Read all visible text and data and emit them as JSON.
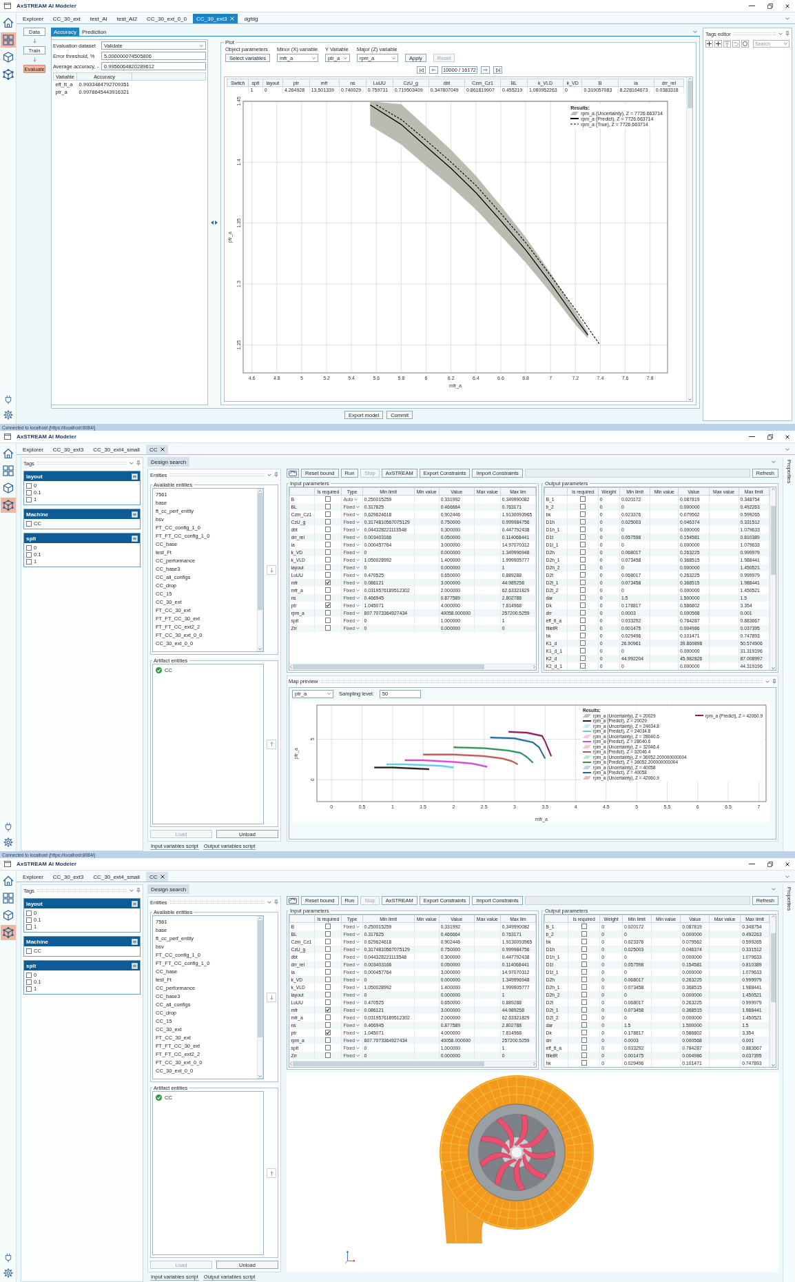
{
  "windows": [
    {
      "kind": "evaluate",
      "title": "AxSTREAM AI Modeler",
      "rail": [
        {
          "selected": false
        },
        {
          "selected": true
        },
        {
          "selected": false
        },
        {
          "selected": false
        }
      ],
      "tabs_focused": true,
      "tabs": [
        {
          "label": "Explorer",
          "selected": false
        },
        {
          "label": "CC_30_ext",
          "selected": false
        },
        {
          "label": "test_AI",
          "selected": false
        },
        {
          "label": "test_AI2",
          "selected": false
        },
        {
          "label": "CC_30_ext_0_0",
          "selected": false
        },
        {
          "label": "CC_30_ext3",
          "selected": true
        },
        {
          "label": "dgfdg",
          "selected": false
        }
      ],
      "steps": [
        {
          "label": "Data",
          "selected": false
        },
        {
          "label": "Train",
          "selected": false
        },
        {
          "label": "Evaluate",
          "selected": true
        }
      ],
      "panel_tabs": [
        {
          "label": "Accuracy",
          "selected": true
        },
        {
          "label": "Prediction",
          "selected": false
        }
      ],
      "fields": [
        {
          "kind": "dropdown",
          "label": "Evaluation dataset",
          "value": "Validate"
        },
        {
          "kind": "text",
          "label": "Error threshold, %",
          "value": "5.000000074505806"
        },
        {
          "kind": "text",
          "label": "Average accuracy, -",
          "value": "0.9956064820289612"
        }
      ],
      "accuracy_table": {
        "columns": [
          "Variable",
          "Accuracy"
        ],
        "rows": [
          [
            "eff_tt_a",
            "0.9933484792709351"
          ],
          [
            "ptr_a",
            "0.9978645443916321"
          ]
        ]
      },
      "plot": {
        "title": "Plot",
        "controls": [
          {
            "kind": "button",
            "label": "Object parameters",
            "value": "Select variables"
          },
          {
            "kind": "dropdown",
            "label": "Minor (X) variable",
            "value": "mfr_a"
          },
          {
            "kind": "dropdown",
            "label": "Y Variable",
            "value": "ptr_a"
          },
          {
            "kind": "dropdown",
            "label": "Major (Z) variable",
            "value": "rpm_a"
          }
        ],
        "actions": [
          {
            "label": "Apply",
            "disabled": false
          },
          {
            "label": "Reset",
            "disabled": true
          }
        ],
        "pager": "10000 / 16172",
        "table": {
          "columns": [
            "Switch",
            "splt",
            "layout",
            "ptr",
            "mfr",
            "ns",
            "LuUU",
            "CzU_g",
            "dbt",
            "Czm_Cz1",
            "BL",
            "k_VLD",
            "k_VD",
            "B",
            "ia",
            "drr_rel"
          ],
          "rows": [
            [
              null,
              "1",
              "0",
              "4.264928",
              "13.501339",
              "0.740029",
              "0.759731",
              "0.719503409",
              "0.347807049",
              "0.861819907",
              "0.455219",
              "1.080952263",
              "0",
              "0.319057083",
              "8.228164673",
              "0.0383318"
            ]
          ]
        },
        "uncertainty": [
          {
            "label": "rpm_a (Uncertainty), Z = 7726.663714",
            "color": "#b9bdb1"
          }
        ],
        "chart_data": {
          "type": "line",
          "xlabel": "mfr_a",
          "ylabel": "ptr_a",
          "grid": true,
          "legend": "upper right",
          "legend_title": "Results:",
          "xlim": [
            4.53,
            7.94
          ],
          "ylim": [
            1.227,
            1.45
          ],
          "xticks": [
            4.6,
            4.8,
            5,
            5.2,
            5.4,
            5.6,
            5.8,
            6,
            6.2,
            6.4,
            6.6,
            6.8,
            7,
            7.2,
            7.4,
            7.6,
            7.8
          ],
          "yticks": [
            1.25,
            1.3,
            1.35,
            1.4,
            1.45
          ],
          "series": [
            {
              "name": "rpm_a (Predict), Z = 7726.663714",
              "color": "#000000",
              "x": [
                5.55,
                5.8,
                6.0,
                6.2,
                6.4,
                6.6,
                6.8,
                7.0,
                7.2,
                7.3
              ],
              "values": [
                1.447,
                1.431,
                1.413,
                1.395,
                1.375,
                1.352,
                1.328,
                1.301,
                1.272,
                1.258
              ]
            },
            {
              "name": "rpm_a (True), Z = 7726.663714",
              "color": "#000000",
              "line_style": "dashed",
              "x": [
                5.6,
                5.8,
                6.0,
                6.2,
                6.4,
                6.6,
                6.8,
                7.0,
                7.2,
                7.39
              ],
              "values": [
                1.447,
                1.435,
                1.418,
                1.4,
                1.381,
                1.358,
                1.334,
                1.307,
                1.279,
                1.251
              ]
            }
          ]
        }
      },
      "footer_buttons": [
        "Export model",
        "Commit"
      ],
      "tags_editor": {
        "title": "Tags editor",
        "search_placeholder": "Search"
      },
      "status": "Connected to localhost (https://localhost:8084/)"
    },
    {
      "kind": "design_search",
      "title": "AxSTREAM AI Modeler",
      "rail": [
        {
          "selected": false
        },
        {
          "selected": false
        },
        {
          "selected": false
        },
        {
          "selected": true
        }
      ],
      "tabs_focused": false,
      "tabs": [
        {
          "label": "Explorer",
          "selected": false
        },
        {
          "label": "CC_30_ext3",
          "selected": false
        },
        {
          "label": "CC_30_ext4_small",
          "selected": false
        },
        {
          "label": "CC",
          "selected": true
        }
      ],
      "tags": {
        "title": "Tags",
        "groups": [
          {
            "name": "layout",
            "options": [
              {
                "label": "0",
                "checked": false
              },
              {
                "label": "0.1",
                "checked": false
              },
              {
                "label": "1",
                "checked": false
              }
            ]
          },
          {
            "name": "Machine",
            "options": [
              {
                "label": "CC",
                "checked": false
              }
            ]
          },
          {
            "name": "splt",
            "options": [
              {
                "label": "0",
                "checked": false
              },
              {
                "label": "0.1",
                "checked": false
              },
              {
                "label": "1",
                "checked": false
              }
            ]
          }
        ]
      },
      "page_tabs": [
        {
          "label": "Design search",
          "selected": true
        }
      ],
      "entities": {
        "title": "Entities",
        "available_title": "Available entities",
        "available": [
          "7561",
          "base",
          "ft_cc_perf_entity",
          "bsv",
          "FT_CC_config_1_0",
          "FT_FT_CC_config_1_0",
          "CC_base",
          "test_Ft",
          "CC_performance",
          "CC_base3",
          "CC_all_configs",
          "CC_drop",
          "CC_15",
          "CC_30_ext",
          "FT_CC_30_ext",
          "FT_FT_CC_30_ext",
          "FT_FT_CC_ext2_2",
          "FT_CC_30_ext_0_0",
          "CC_30_ext_0_0"
        ],
        "artifact_title": "Artifact entities",
        "artifacts": [
          "CC"
        ],
        "buttons": [
          {
            "label": "Load",
            "disabled": true
          },
          {
            "label": "Unload",
            "disabled": false
          }
        ]
      },
      "toolbar": [
        {
          "label": "Reset bound",
          "disabled": false
        },
        {
          "label": "Run",
          "disabled": false
        },
        {
          "label": "Stop",
          "disabled": true
        },
        {
          "label": "AxSTREAM",
          "disabled": false
        },
        {
          "label": "Export Constraints",
          "disabled": false
        },
        {
          "label": "Import Constraints",
          "disabled": false
        }
      ],
      "refresh": "Refresh",
      "inputs": {
        "kind": "input",
        "title": "Input parameters",
        "columns": [
          "Is required",
          "Type",
          "Min limit",
          "Min value",
          "Value",
          "Max value",
          "Max lim"
        ],
        "rows": [
          {
            "name": "B",
            "required": false,
            "type": "Auto",
            "min_limit": "0.250015259",
            "value": "0.331992",
            "max_limit": "0.349990082"
          },
          {
            "name": "BL",
            "required": false,
            "type": "Fixed",
            "min_limit": "0.317625",
            "value": "0.466664",
            "max_limit": "0.763171"
          },
          {
            "name": "Czm_Cz1",
            "required": false,
            "type": "Fixed",
            "min_limit": "0.629624618",
            "value": "0.902446",
            "max_limit": "1.9130093965"
          },
          {
            "name": "CzU_g",
            "required": false,
            "type": "Fixed",
            "min_limit": "0.3174810567075129",
            "value": "0.750000",
            "max_limit": "0.999984756"
          },
          {
            "name": "dbt",
            "required": false,
            "type": "Fixed",
            "min_limit": "0.044328221113548",
            "value": "0.300000",
            "max_limit": "0.447792438"
          },
          {
            "name": "drr_rel",
            "required": false,
            "type": "Fixed",
            "min_limit": "0.003403166",
            "value": "0.050000",
            "max_limit": "0.114068441"
          },
          {
            "name": "ia",
            "required": false,
            "type": "Fixed",
            "min_limit": "0.000457764",
            "value": "3.000000",
            "max_limit": "14.97070312"
          },
          {
            "name": "k_VD",
            "required": false,
            "type": "Fixed",
            "min_limit": "0",
            "value": "0.000000",
            "max_limit": "1.349996948"
          },
          {
            "name": "k_VLD",
            "required": false,
            "type": "Fixed",
            "min_limit": "1.050028992",
            "value": "1.400000",
            "max_limit": "1.999905777"
          },
          {
            "name": "layout",
            "required": false,
            "type": "Fixed",
            "min_limit": "0",
            "value": "0.000000",
            "max_limit": "1"
          },
          {
            "name": "LuUU",
            "required": false,
            "type": "Fixed",
            "min_limit": "0.470525",
            "value": "0.650000",
            "max_limit": "0.889288"
          },
          {
            "name": "mfr",
            "required": true,
            "type": "Fixed",
            "min_limit": "0.086121",
            "value": "3.000000",
            "max_limit": "44.989258"
          },
          {
            "name": "mfr_a",
            "required": false,
            "type": "Fixed",
            "min_limit": "0.0319576189512302",
            "value": "2.000000",
            "max_limit": "62.63321829"
          },
          {
            "name": "ns",
            "required": false,
            "type": "Fixed",
            "min_limit": "0.466945",
            "value": "0.877589",
            "max_limit": "2.802788"
          },
          {
            "name": "ptr",
            "required": true,
            "type": "Fixed",
            "min_limit": "1.045071",
            "value": "4.000000",
            "max_limit": "7.814968"
          },
          {
            "name": "rpm_a",
            "required": false,
            "type": "Fixed",
            "min_limit": "807.7073364927434",
            "value": "40058.000000",
            "max_limit": "257200.5259"
          },
          {
            "name": "splt",
            "required": false,
            "type": "Fixed",
            "min_limit": "0",
            "value": "1.000000",
            "max_limit": "1"
          },
          {
            "name": "Zrr",
            "required": false,
            "type": "Fixed",
            "min_limit": "0",
            "value": "0.000000",
            "max_limit": "0"
          }
        ]
      },
      "outputs": {
        "kind": "output",
        "title": "Output parameters",
        "columns": [
          "Is required",
          "Weight",
          "Min limit",
          "Min value",
          "Value",
          "Max value",
          "Max limit"
        ],
        "rows": [
          {
            "name": "B_1",
            "required": false,
            "weight": "0",
            "min_limit": "0.020172",
            "value": "0.087819",
            "max_limit": "0.348754"
          },
          {
            "name": "b_2",
            "required": false,
            "weight": "0",
            "min_limit": "0",
            "value": "0.000000",
            "max_limit": "0.492263"
          },
          {
            "name": "bk",
            "required": false,
            "weight": "0",
            "min_limit": "0.023376",
            "value": "0.079562",
            "max_limit": "0.599265"
          },
          {
            "name": "D1h",
            "required": false,
            "weight": "0",
            "min_limit": "0.025003",
            "value": "0.046374",
            "max_limit": "0.331512"
          },
          {
            "name": "D1h_1",
            "required": false,
            "weight": "0",
            "min_limit": "0",
            "value": "0.000000",
            "max_limit": "1.079633"
          },
          {
            "name": "D1t",
            "required": false,
            "weight": "0",
            "min_limit": "0.057598",
            "value": "0.154581",
            "max_limit": "0.810389"
          },
          {
            "name": "D1t_1",
            "required": false,
            "weight": "0",
            "min_limit": "0",
            "value": "0.000000",
            "max_limit": "1.079633"
          },
          {
            "name": "D2h",
            "required": false,
            "weight": "0",
            "min_limit": "0.068017",
            "value": "0.263225",
            "max_limit": "0.999979"
          },
          {
            "name": "D2h_1",
            "required": false,
            "weight": "0",
            "min_limit": "0.073458",
            "value": "0.368515",
            "max_limit": "1.988441"
          },
          {
            "name": "D2h_2",
            "required": false,
            "weight": "0",
            "min_limit": "0",
            "value": "0.000000",
            "max_limit": "1.450521"
          },
          {
            "name": "D2t",
            "required": false,
            "weight": "0",
            "min_limit": "0.068017",
            "value": "0.263225",
            "max_limit": "0.999979"
          },
          {
            "name": "D2t_1",
            "required": false,
            "weight": "0",
            "min_limit": "0.073458",
            "value": "0.368515",
            "max_limit": "1.988441"
          },
          {
            "name": "D2t_2",
            "required": false,
            "weight": "0",
            "min_limit": "0",
            "value": "0.000000",
            "max_limit": "1.450521"
          },
          {
            "name": "dar",
            "required": false,
            "weight": "0",
            "min_limit": "1.5",
            "value": "1.500000",
            "max_limit": "1.5"
          },
          {
            "name": "Dk",
            "required": false,
            "weight": "0",
            "min_limit": "0.178817",
            "value": "0.586802",
            "max_limit": "3.354"
          },
          {
            "name": "drr",
            "required": false,
            "weight": "0",
            "min_limit": "0.0003",
            "value": "0.000568",
            "max_limit": "0.001"
          },
          {
            "name": "eff_tt_a",
            "required": false,
            "weight": "0",
            "min_limit": "0.033292",
            "value": "0.784287",
            "max_limit": "0.883667"
          },
          {
            "name": "filletR",
            "required": false,
            "weight": "0",
            "min_limit": "0.001475",
            "value": "0.004986",
            "max_limit": "0.037395"
          },
          {
            "name": "hk",
            "required": false,
            "weight": "0",
            "min_limit": "0.029496",
            "value": "0.101471",
            "max_limit": "0.747893"
          },
          {
            "name": "K1_d",
            "required": false,
            "weight": "0",
            "min_limit": "26.90961",
            "value": "39.869898",
            "max_limit": "50.574906"
          },
          {
            "name": "K1_d_1",
            "required": false,
            "weight": "0",
            "min_limit": "0",
            "value": "0.000000",
            "max_limit": "31.319196"
          },
          {
            "name": "K2_d",
            "required": false,
            "weight": "0",
            "min_limit": "44.992204",
            "value": "45.982826",
            "max_limit": "87.008997"
          },
          {
            "name": "K2_d_1",
            "required": false,
            "weight": "0",
            "min_limit": "0",
            "value": "0.000000",
            "max_limit": "44.319196"
          }
        ]
      },
      "view": {
        "kind": "map",
        "title": "Map preview",
        "variable": "ptr_a",
        "sampling_label": "Sampling level:",
        "sampling_value": "50",
        "uncertainty": [
          {
            "label": "rpm_a (Uncertainty), Z = 20029",
            "color": "#bcc0b4"
          },
          {
            "label": "rpm_a (Uncertainty), Z = 24034.8",
            "color": "#c6ecf4"
          },
          {
            "label": "rpm_a (Uncertainty), Z = 28040.6",
            "color": "#f2c4ec"
          },
          {
            "label": "rpm_a (Uncertainty), Z = 32046.4",
            "color": "#f0c6c2"
          },
          {
            "label": "rpm_a (Uncertainty), Z = 36052.200000000004",
            "color": "#c4e4d0"
          },
          {
            "label": "rpm_a (Uncertainty), Z = 40058",
            "color": "#b4d8ea"
          },
          {
            "label": "rpm_a (Uncertainty), Z = 42060.9",
            "color": "#e8b8cc"
          }
        ],
        "chart_data": {
          "type": "line",
          "xlabel": "mfr_a",
          "ylabel": "ptr_a",
          "grid": true,
          "legend": "upper right",
          "legend_title": "Results:",
          "xlim": [
            -0.24,
            7.12
          ],
          "ylim": [
            -2.7,
            9.2
          ],
          "xticks": [
            {
              "value": 0,
              "label": "0"
            },
            0.5,
            {
              "value": 1,
              "label": "1"
            },
            {
              "value": 1.5,
              "label": "1.5"
            },
            2,
            2.5,
            3,
            3.5,
            4,
            4.5,
            5,
            5.5,
            6,
            6.5,
            7
          ],
          "yticks": [
            {
              "value": 0,
              "label": "0"
            },
            5
          ],
          "series": [
            {
              "name": "rpm_a (Predict), Z = 20029",
              "color": "#1e1e1e",
              "x": [
                0.7,
                1.0,
                1.3,
                1.6
              ],
              "values": [
                1.5,
                1.5,
                1.4,
                1.3
              ]
            },
            {
              "name": "rpm_a (Predict), Z = 24034.8",
              "color": "#5ccfe0",
              "x": [
                0.9,
                1.2,
                1.5,
                1.8,
                2.0
              ],
              "values": [
                1.9,
                1.9,
                1.8,
                1.7,
                1.5
              ]
            },
            {
              "name": "rpm_a (Predict), Z = 28040.6",
              "color": "#c84fd0",
              "x": [
                1.2,
                1.5,
                2.0,
                2.3,
                2.55
              ],
              "values": [
                2.4,
                2.4,
                2.2,
                2.0,
                1.6
              ]
            },
            {
              "name": "rpm_a (Predict), Z = 32046.4",
              "color": "#b85a5a",
              "x": [
                1.5,
                2.0,
                2.5,
                2.8,
                2.95,
                3.05
              ],
              "values": [
                3.1,
                3.1,
                2.9,
                2.6,
                2.3,
                1.9
              ]
            },
            {
              "name": "rpm_a (Predict), Z = 36052.200000000004",
              "color": "#2e8f5a",
              "x": [
                2.0,
                2.5,
                2.9,
                3.1,
                3.2,
                3.3
              ],
              "values": [
                4.0,
                3.9,
                3.6,
                3.3,
                2.8,
                2.1
              ]
            },
            {
              "name": "rpm_a (Predict), Z = 40058",
              "color": "#1f6b94",
              "x": [
                2.6,
                3.0,
                3.3,
                3.4,
                3.45,
                3.5
              ],
              "values": [
                5.2,
                5.1,
                4.6,
                4.0,
                3.3,
                2.6
              ]
            },
            {
              "name": "rpm_a (Predict), Z = 42060.9",
              "color": "#8c1c5a",
              "x": [
                2.9,
                3.2,
                3.45,
                3.5,
                3.55,
                3.6
              ],
              "values": [
                5.9,
                5.8,
                5.4,
                4.7,
                3.8,
                2.9
              ]
            }
          ]
        }
      },
      "bottom_tabs": [
        "Input variables script",
        "Output variables script"
      ],
      "side_tab": "Properties",
      "status": "Connected to localhost (https://localhost:8084/)"
    },
    {
      "kind": "design_search",
      "title": "AxSTREAM AI Modeler",
      "rail": [
        {
          "selected": false
        },
        {
          "selected": false
        },
        {
          "selected": false
        },
        {
          "selected": true
        }
      ],
      "tabs_focused": false,
      "tabs": [
        {
          "label": "Explorer",
          "selected": false
        },
        {
          "label": "CC_30_ext3",
          "selected": false
        },
        {
          "label": "CC_30_ext4_small",
          "selected": false
        },
        {
          "label": "CC",
          "selected": true
        }
      ],
      "tags": {
        "title": "Tags",
        "groups": [
          {
            "name": "layout",
            "options": [
              {
                "label": "0",
                "checked": false
              },
              {
                "label": "0.1",
                "checked": false
              },
              {
                "label": "1",
                "checked": false
              }
            ]
          },
          {
            "name": "Machine",
            "options": [
              {
                "label": "CC",
                "checked": false
              }
            ]
          },
          {
            "name": "splt",
            "options": [
              {
                "label": "0",
                "checked": false
              },
              {
                "label": "0.1",
                "checked": false
              },
              {
                "label": "1",
                "checked": false
              }
            ]
          }
        ]
      },
      "page_tabs": [
        {
          "label": "Design search",
          "selected": true
        }
      ],
      "entities": {
        "title": "Entities",
        "available_title": "Available entities",
        "available": [
          "7561",
          "base",
          "ft_cc_perf_entity",
          "bsv",
          "FT_CC_config_1_0",
          "FT_FT_CC_config_1_0",
          "CC_base",
          "test_Ft",
          "CC_performance",
          "CC_base3",
          "CC_all_configs",
          "CC_drop",
          "CC_15",
          "CC_30_ext",
          "FT_CC_30_ext",
          "FT_FT_CC_30_ext",
          "FT_FT_CC_ext2_2",
          "FT_CC_30_ext_0_0",
          "CC_30_ext_0_0"
        ],
        "artifact_title": "Artifact entities",
        "artifacts": [
          "CC"
        ],
        "buttons": [
          {
            "label": "Load",
            "disabled": true
          },
          {
            "label": "Unload",
            "disabled": false
          }
        ]
      },
      "toolbar": [
        {
          "label": "Reset bound",
          "disabled": false
        },
        {
          "label": "Run",
          "disabled": false
        },
        {
          "label": "Stop",
          "disabled": true
        },
        {
          "label": "AxSTREAM",
          "disabled": false
        },
        {
          "label": "Export Constraints",
          "disabled": false
        },
        {
          "label": "Import Constraints",
          "disabled": false
        }
      ],
      "refresh": "Refresh",
      "inputs": {
        "kind": "input",
        "title": "Input parameters",
        "columns": [
          "Is required",
          "Type",
          "Min limit",
          "Min value",
          "Value",
          "Max value",
          "Max lim"
        ],
        "rows": [
          {
            "name": "B",
            "required": false,
            "type": "Fixed",
            "min_limit": "0.250015259",
            "value": "0.331992",
            "max_limit": "0.349990082"
          },
          {
            "name": "BL",
            "required": false,
            "type": "Fixed",
            "min_limit": "0.317625",
            "value": "0.466664",
            "max_limit": "0.763171"
          },
          {
            "name": "Czm_Cz1",
            "required": false,
            "type": "Fixed",
            "min_limit": "0.629624618",
            "value": "0.902446",
            "max_limit": "1.9130093965"
          },
          {
            "name": "CzU_g",
            "required": false,
            "type": "Fixed",
            "min_limit": "0.3174810567075129",
            "value": "0.750000",
            "max_limit": "0.999984756"
          },
          {
            "name": "dbt",
            "required": false,
            "type": "Fixed",
            "min_limit": "0.044328221113548",
            "value": "0.300000",
            "max_limit": "0.447792438"
          },
          {
            "name": "drr_rel",
            "required": false,
            "type": "Fixed",
            "min_limit": "0.003403166",
            "value": "0.050000",
            "max_limit": "0.114068441"
          },
          {
            "name": "ia",
            "required": false,
            "type": "Fixed",
            "min_limit": "0.000457764",
            "value": "3.000000",
            "max_limit": "14.97070312"
          },
          {
            "name": "k_VD",
            "required": false,
            "type": "Fixed",
            "min_limit": "0",
            "value": "0.000000",
            "max_limit": "1.349996948"
          },
          {
            "name": "k_VLD",
            "required": false,
            "type": "Fixed",
            "min_limit": "1.050028992",
            "value": "1.400000",
            "max_limit": "1.999905777"
          },
          {
            "name": "layout",
            "required": false,
            "type": "Fixed",
            "min_limit": "0",
            "value": "0.000000",
            "max_limit": "1"
          },
          {
            "name": "LuUU",
            "required": false,
            "type": "Fixed",
            "min_limit": "0.470525",
            "value": "0.650000",
            "max_limit": "0.889288"
          },
          {
            "name": "mfr",
            "required": true,
            "type": "Fixed",
            "min_limit": "0.086121",
            "value": "3.000000",
            "max_limit": "44.989258"
          },
          {
            "name": "mfr_a",
            "required": false,
            "type": "Fixed",
            "min_limit": "0.0319576189512302",
            "value": "2.000000",
            "max_limit": "62.63321829"
          },
          {
            "name": "ns",
            "required": false,
            "type": "Fixed",
            "min_limit": "0.466945",
            "value": "0.877589",
            "max_limit": "2.802788"
          },
          {
            "name": "ptr",
            "required": true,
            "type": "Fixed",
            "min_limit": "1.045071",
            "value": "4.000000",
            "max_limit": "7.814968"
          },
          {
            "name": "rpm_a",
            "required": false,
            "type": "Fixed",
            "min_limit": "807.7073364927434",
            "value": "40058.000000",
            "max_limit": "257200.5259"
          },
          {
            "name": "splt",
            "required": false,
            "type": "Fixed",
            "min_limit": "0",
            "value": "1.000000",
            "max_limit": "1"
          },
          {
            "name": "Zrr",
            "required": false,
            "type": "Fixed",
            "min_limit": "0",
            "value": "0.000000",
            "max_limit": "0"
          }
        ]
      },
      "outputs": {
        "kind": "output",
        "title": "Output parameters",
        "columns": [
          "Is required",
          "Weight",
          "Min limit",
          "Min value",
          "Value",
          "Max value",
          "Max limit"
        ],
        "rows": [
          {
            "name": "B_1",
            "required": false,
            "weight": "0",
            "min_limit": "0.020172",
            "value": "0.087819",
            "max_limit": "0.348754"
          },
          {
            "name": "b_2",
            "required": false,
            "weight": "0",
            "min_limit": "0",
            "value": "0.000000",
            "max_limit": "0.492263"
          },
          {
            "name": "bk",
            "required": false,
            "weight": "0",
            "min_limit": "0.023376",
            "value": "0.079562",
            "max_limit": "0.599265"
          },
          {
            "name": "D1h",
            "required": false,
            "weight": "0",
            "min_limit": "0.025003",
            "value": "0.046374",
            "max_limit": "0.331512"
          },
          {
            "name": "D1h_1",
            "required": false,
            "weight": "0",
            "min_limit": "0",
            "value": "0.000000",
            "max_limit": "1.079633"
          },
          {
            "name": "D1t",
            "required": false,
            "weight": "0",
            "min_limit": "0.057598",
            "value": "0.154581",
            "max_limit": "0.810389"
          },
          {
            "name": "D1t_1",
            "required": false,
            "weight": "0",
            "min_limit": "0",
            "value": "0.000000",
            "max_limit": "1.079633"
          },
          {
            "name": "D2h",
            "required": false,
            "weight": "0",
            "min_limit": "0.068017",
            "value": "0.263225",
            "max_limit": "0.999979"
          },
          {
            "name": "D2h_1",
            "required": false,
            "weight": "0",
            "min_limit": "0.073458",
            "value": "0.368515",
            "max_limit": "1.988441"
          },
          {
            "name": "D2h_2",
            "required": false,
            "weight": "0",
            "min_limit": "0",
            "value": "0.000000",
            "max_limit": "1.450521"
          },
          {
            "name": "D2t",
            "required": false,
            "weight": "0",
            "min_limit": "0.068017",
            "value": "0.263225",
            "max_limit": "0.999979"
          },
          {
            "name": "D2t_1",
            "required": false,
            "weight": "0",
            "min_limit": "0.073458",
            "value": "0.368515",
            "max_limit": "1.988441"
          },
          {
            "name": "D2t_2",
            "required": false,
            "weight": "0",
            "min_limit": "0",
            "value": "0.000000",
            "max_limit": "1.450521"
          },
          {
            "name": "dar",
            "required": false,
            "weight": "0",
            "min_limit": "1.5",
            "value": "1.500000",
            "max_limit": "1.5"
          },
          {
            "name": "Dk",
            "required": false,
            "weight": "0",
            "min_limit": "0.178817",
            "value": "0.586802",
            "max_limit": "3.354"
          },
          {
            "name": "drr",
            "required": false,
            "weight": "0",
            "min_limit": "0.0003",
            "value": "0.000568",
            "max_limit": "0.001"
          },
          {
            "name": "eff_tt_a",
            "required": false,
            "weight": "0",
            "min_limit": "0.033292",
            "value": "0.784287",
            "max_limit": "0.883667"
          },
          {
            "name": "filletR",
            "required": false,
            "weight": "0",
            "min_limit": "0.001475",
            "value": "0.004986",
            "max_limit": "0.037395"
          },
          {
            "name": "hk",
            "required": false,
            "weight": "0",
            "min_limit": "0.029496",
            "value": "0.101471",
            "max_limit": "0.747893"
          }
        ]
      },
      "view": {
        "kind": "model"
      },
      "bottom_tabs": [
        "Input variables script",
        "Output variables script"
      ],
      "side_tab": "Properties"
    }
  ]
}
